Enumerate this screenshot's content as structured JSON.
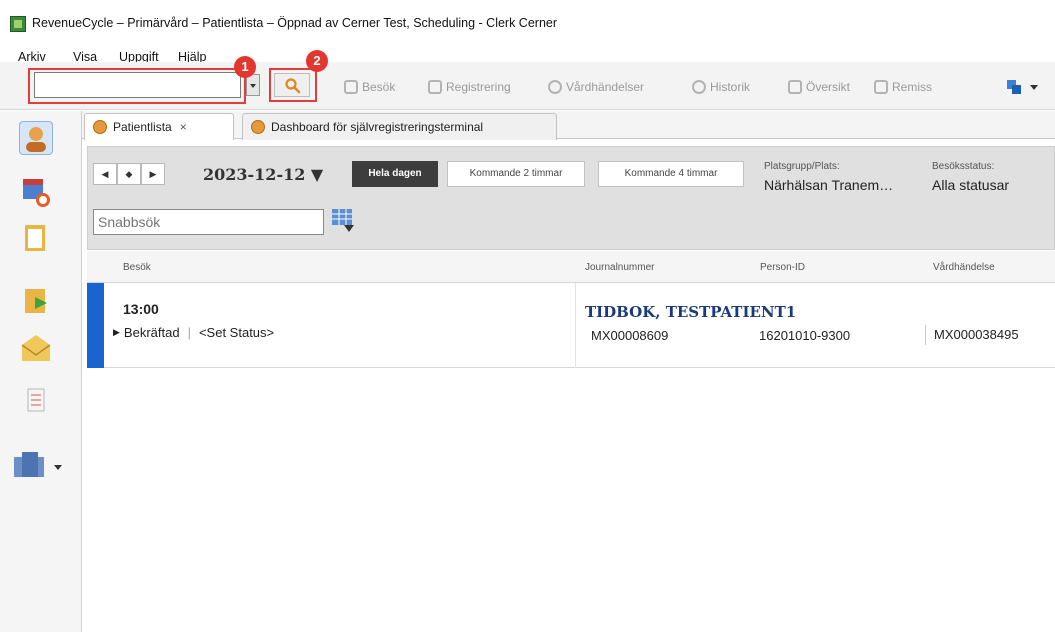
{
  "window": {
    "title": "RevenueCycle – Primärvård – Patientlista – Öppnad av Cerner Test, Scheduling - Clerk Cerner"
  },
  "menu": [
    "Arkiv",
    "Visa",
    "Uppgift",
    "Hjälp"
  ],
  "toolbar": {
    "search_value": "",
    "badges": [
      "1",
      "2"
    ],
    "buttons": [
      "Besök",
      "Registrering",
      "Vårdhändelser",
      "Historik",
      "Översikt",
      "Remiss"
    ]
  },
  "tabs": [
    {
      "label": "Patientlista",
      "close": "×"
    },
    {
      "label": "Dashboard för självregistreringsterminal"
    }
  ],
  "filters": {
    "nav": [
      "◀",
      "◆",
      "▶"
    ],
    "date": "2023-12-12 ▼",
    "segments": [
      "Hela dagen",
      "Kommande 2 timmar",
      "Kommande 4 timmar"
    ],
    "location_label": "Platsgrupp/Plats:",
    "location_value": "Närhälsan Tranem…",
    "status_label": "Besöksstatus:",
    "status_value": "Alla statusar",
    "quick_search_placeholder": "Snabbsök"
  },
  "table": {
    "headers": [
      "Besök",
      "Journalnummer",
      "Person-ID",
      "Vårdhändelse"
    ],
    "rows": [
      {
        "time": "13:00",
        "status": "Bekräftad",
        "set_status": "<Set Status>",
        "patient_name": "TIDBOK, TESTPATIENT1",
        "journal": "MX00008609",
        "person_id": "16201010-9300",
        "vardhandelse": "MX000038495"
      }
    ]
  },
  "colors": {
    "highlight": "#e23d3d",
    "row_accent": "#1a64cf",
    "active_segment": "#3d3d3d"
  }
}
